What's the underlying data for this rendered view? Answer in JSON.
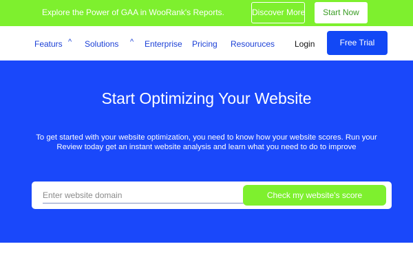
{
  "promo": {
    "text": "Explore the Power of GAA in WooRank's Reports.",
    "discover_label": "Discover More",
    "start_label": "Start Now"
  },
  "nav": {
    "features": "Featurs",
    "solutions": "Solutions",
    "caret": "^",
    "enterprise": "Enterprise",
    "pricing": "Pricing",
    "resources": "Resouruces",
    "login": "Login",
    "trial_label": "Free Trial"
  },
  "hero": {
    "title": "Start Optimizing Your Website",
    "description": "To get started with your website optimization, you need to know how your website scores. Run your Review today get an instant website analysis and learn what you need to do to improve",
    "search_placeholder": "Enter website domain",
    "search_value": "",
    "button_label": "Check my website's score"
  },
  "colors": {
    "accent_green": "#7ef02e",
    "brand_blue": "#1a48fa",
    "nav_text": "#1a3fd6"
  }
}
